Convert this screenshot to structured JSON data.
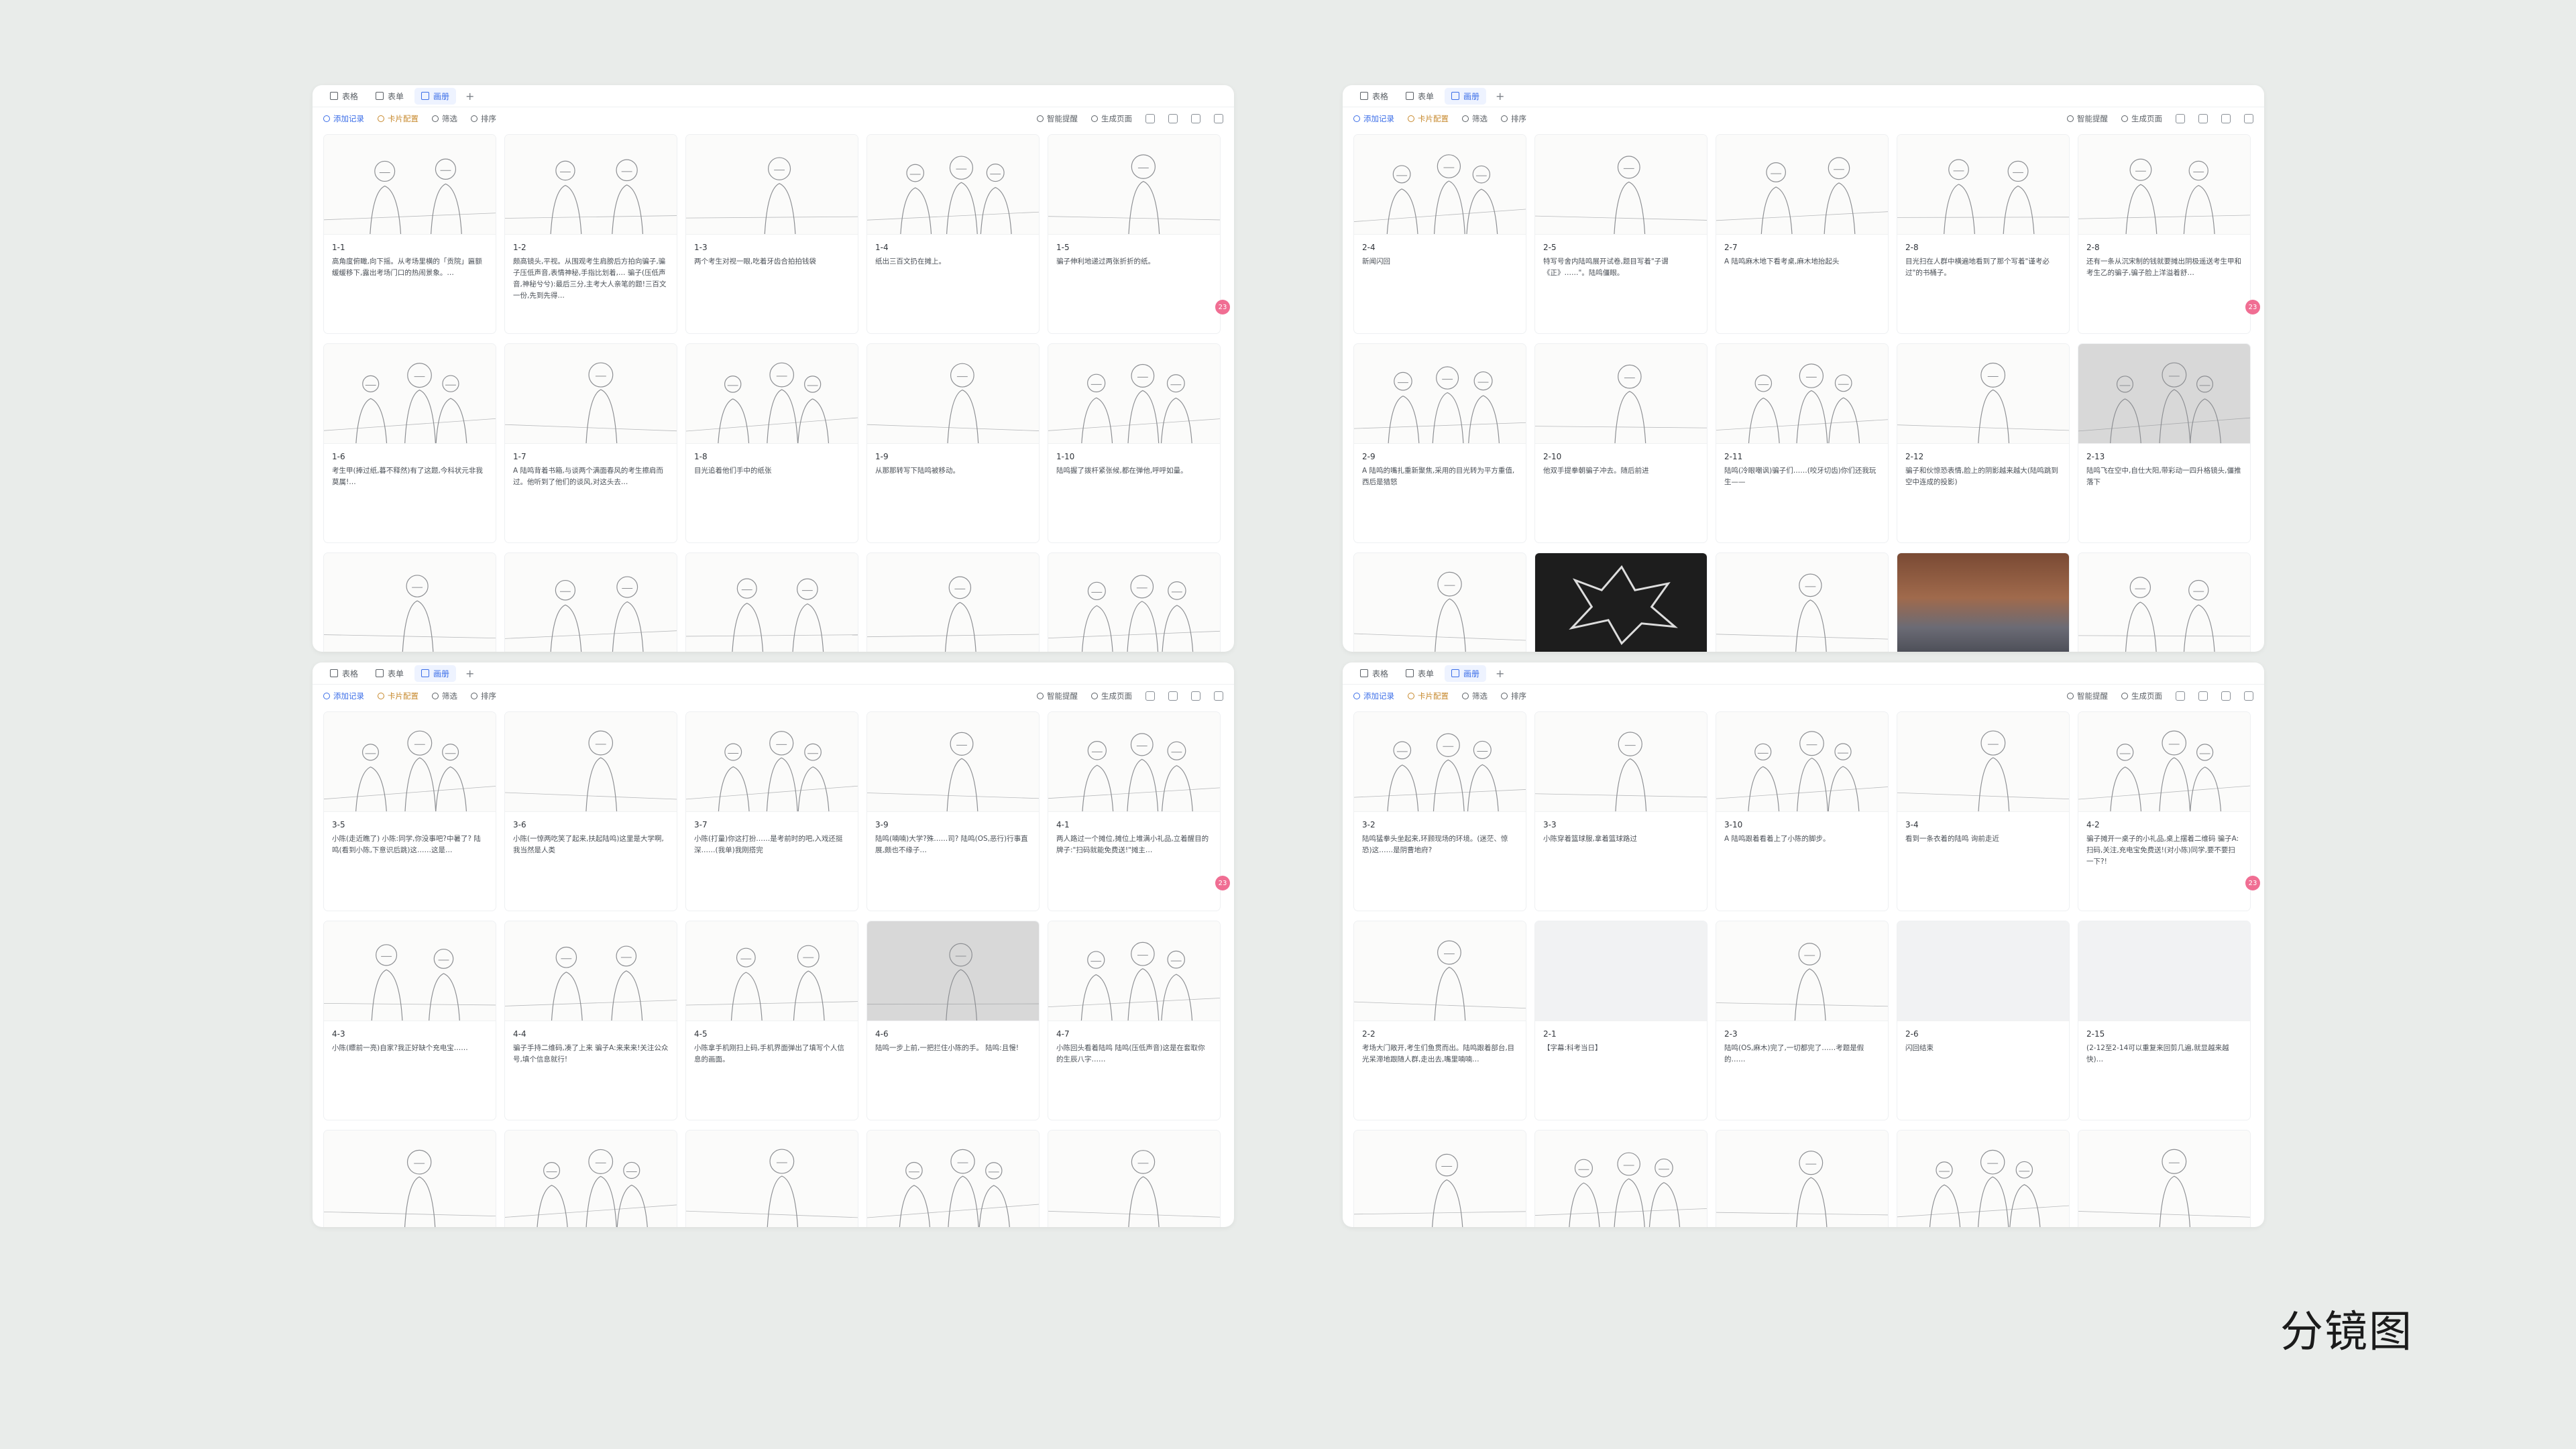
{
  "caption": "分镜图",
  "panels": [
    {
      "tabs": [
        "表格",
        "表单",
        "画册"
      ],
      "active_tab": 2,
      "toolbar": {
        "add": "添加记录",
        "card": "卡片配置",
        "filter": "筛选",
        "sort": "排序",
        "smart": "智能提醒",
        "gen": "生成页面"
      },
      "badge": "23",
      "cards": [
        {
          "id": "1-1",
          "desc": "高角度俯瞰,向下摇。从考场里横的「贡院」匾额缓缓移下,露出考场门口的热闹景象。…",
          "kind": "sketch"
        },
        {
          "id": "1-2",
          "desc": "颇高镜头,平视。从围观考生肩膀后方拍向骗子,骗子压低声音,表情神秘,手指比划着,…  骗子(压低声音,神秘兮兮):最后三分,主考大人亲笔的题!三百文一份,先到先得…",
          "kind": "sketch"
        },
        {
          "id": "1-3",
          "desc": "两个考生对视一眼,吃着牙齿合拍拍钱袋",
          "kind": "sketch"
        },
        {
          "id": "1-4",
          "desc": "纸出三百文扔在摊上。",
          "kind": "sketch"
        },
        {
          "id": "1-5",
          "desc": "骗子伸利地递过两张折折的纸。",
          "kind": "sketch"
        },
        {
          "id": "1-6",
          "desc": "考生甲(捧过纸,暮不释然)有了这题,今科状元非我莫属!…",
          "kind": "sketch"
        },
        {
          "id": "1-7",
          "desc": "A 陆鸣背着书箱,与谈两个满面春风的考生擦肩而过。他听到了他们的谈风,对这头去…",
          "kind": "sketch"
        },
        {
          "id": "1-8",
          "desc": "目光追着他们手中的纸张",
          "kind": "sketch"
        },
        {
          "id": "1-9",
          "desc": "从那那转写下陆鸣被移动。",
          "kind": "sketch"
        },
        {
          "id": "1-10",
          "desc": "陆鸣握了拨杆紧张候,都在弹他,呼呼如量。",
          "kind": "sketch"
        },
        {
          "id": "",
          "desc": "",
          "kind": "sketch"
        },
        {
          "id": "",
          "desc": "",
          "kind": "sketch"
        },
        {
          "id": "",
          "desc": "",
          "kind": "sketch"
        },
        {
          "id": "",
          "desc": "",
          "kind": "sketch"
        },
        {
          "id": "",
          "desc": "",
          "kind": "sketch"
        }
      ]
    },
    {
      "tabs": [
        "表格",
        "表单",
        "画册"
      ],
      "active_tab": 2,
      "toolbar": {
        "add": "添加记录",
        "card": "卡片配置",
        "filter": "筛选",
        "sort": "排序",
        "smart": "智能提醒",
        "gen": "生成页面"
      },
      "badge": "23",
      "cards": [
        {
          "id": "2-4",
          "desc": "新闻闪回",
          "kind": "sketch"
        },
        {
          "id": "2-5",
          "desc": "特写号舍内陆鸣展开试卷,题目写着\"子谓《正》……\"。陆鸣僵眼。",
          "kind": "sketch"
        },
        {
          "id": "2-7",
          "desc": "A 陆鸣麻木地下看考桌,麻木地抬起头",
          "kind": "sketch"
        },
        {
          "id": "2-8",
          "desc": "目光扫在人群中横遍地看到了那个写着\"谨考必过\"的书桶子。",
          "kind": "sketch"
        },
        {
          "id": "2-8",
          "desc": "还有一条从沉宋制的钱就要摊出阴极遥送考生甲和考生乙的骗子,骗子脸上洋溢着舒…",
          "kind": "sketch"
        },
        {
          "id": "2-9",
          "desc": "A 陆鸣的嘴扎重新聚焦,采用的目光转为平方重值,西后是猎怒",
          "kind": "sketch"
        },
        {
          "id": "2-10",
          "desc": "他双手提拳朝骗子冲去。随后前进",
          "kind": "sketch"
        },
        {
          "id": "2-11",
          "desc": "陆鸣(冷眼嘲讽)骗子们……(咬牙切齿)你们还我玩生——",
          "kind": "sketch"
        },
        {
          "id": "2-12",
          "desc": "骗子和伙惊恐表情,脸上的阴影越来越大(陆鸣跳到空中连成的投影)",
          "kind": "sketch"
        },
        {
          "id": "2-13",
          "desc": "陆鸣飞在空中,自仕大阳,带彩动一四升格镜头,僵推落下",
          "kind": "sketch-dark"
        },
        {
          "id": "",
          "desc": "",
          "kind": "sketch"
        },
        {
          "id": "",
          "desc": "",
          "kind": "dark"
        },
        {
          "id": "",
          "desc": "",
          "kind": "sketch"
        },
        {
          "id": "",
          "desc": "",
          "kind": "photo"
        },
        {
          "id": "",
          "desc": "",
          "kind": "sketch"
        }
      ]
    },
    {
      "tabs": [
        "表格",
        "表单",
        "画册"
      ],
      "active_tab": 2,
      "toolbar": {
        "add": "添加记录",
        "card": "卡片配置",
        "filter": "筛选",
        "sort": "排序",
        "smart": "智能提醒",
        "gen": "生成页面"
      },
      "badge": "23",
      "cards": [
        {
          "id": "3-5",
          "desc": "小陈(走近瞧了)  小陈:同学,你没事吧?中暑了?  陆鸣(看到小陈,下意识后跳)这……这是…",
          "kind": "sketch"
        },
        {
          "id": "3-6",
          "desc": "小陈(一惊两吃笑了起来,扶起陆鸣)这里是大学啊,我当然是人类",
          "kind": "sketch"
        },
        {
          "id": "3-7",
          "desc": "小陈(打量)你这打扮……是考前时的吧,入戏还挺深……(我单)我刚搭完",
          "kind": "sketch"
        },
        {
          "id": "3-9",
          "desc": "陆鸣(喃喃)大学?殊……司?  陆鸣(OS,恶行)行事直展,颇也不缘子…",
          "kind": "sketch"
        },
        {
          "id": "4-1",
          "desc": "两人路过一个摊位,摊位上堆满小礼品,立着醒目的牌子:\"扫码就能免费送!\"摊主…",
          "kind": "sketch"
        },
        {
          "id": "4-3",
          "desc": "小陈(瞟前一亮)自家?我正好缺个充电宝……",
          "kind": "sketch"
        },
        {
          "id": "4-4",
          "desc": "骗子手持二维码,凑了上来  骗子A:来来来!关注公众号,填个信息就行!",
          "kind": "sketch"
        },
        {
          "id": "4-5",
          "desc": "小陈拿手机刚扫上码,手机界面弹出了填写个人信息的画面。",
          "kind": "sketch"
        },
        {
          "id": "4-6",
          "desc": "陆鸣一步上前,一把拦住小陈的手。  陆鸣:且慢!",
          "kind": "sketch-dark"
        },
        {
          "id": "4-7",
          "desc": "小陈回头看着陆鸣  陆鸣(压低声音)这是在套取你的生辰八字……",
          "kind": "sketch"
        },
        {
          "id": "",
          "desc": "",
          "kind": "sketch"
        },
        {
          "id": "",
          "desc": "",
          "kind": "sketch"
        },
        {
          "id": "",
          "desc": "",
          "kind": "sketch"
        },
        {
          "id": "",
          "desc": "",
          "kind": "sketch"
        },
        {
          "id": "",
          "desc": "",
          "kind": "sketch"
        }
      ]
    },
    {
      "tabs": [
        "表格",
        "表单",
        "画册"
      ],
      "active_tab": 2,
      "toolbar": {
        "add": "添加记录",
        "card": "卡片配置",
        "filter": "筛选",
        "sort": "排序",
        "smart": "智能提醒",
        "gen": "生成页面"
      },
      "badge": "23",
      "cards": [
        {
          "id": "3-2",
          "desc": "陆鸣猛拳头坐起来,环顾现场的环境。(迷茫、惊恐)这……是阴曹地府?",
          "kind": "sketch"
        },
        {
          "id": "3-3",
          "desc": "小陈穿着篮球服,拿着篮球路过",
          "kind": "sketch"
        },
        {
          "id": "3-10",
          "desc": "A 陆鸣跟着看着上了小陈的脚步。",
          "kind": "sketch"
        },
        {
          "id": "3-4",
          "desc": "看到一条衣着的陆鸣  询前走近",
          "kind": "sketch"
        },
        {
          "id": "4-2",
          "desc": "骗子摊开一桌子的小礼品,桌上摆着二维码  骗子A:扫码,关注,充电宝免费送!(对小陈)同学,要不要扫一下?!",
          "kind": "sketch"
        },
        {
          "id": "2-2",
          "desc": "考场大门敞开,考生们鱼贯而出。陆鸣跟着部台,目光呆滞地跟随人群,走出去,嘴里喃喃…",
          "kind": "sketch"
        },
        {
          "id": "2-1",
          "desc": "【字幕:科考当日】",
          "kind": "blank"
        },
        {
          "id": "2-3",
          "desc": "陆鸣(OS,麻木)完了,一切都完了……考题是假的……",
          "kind": "sketch"
        },
        {
          "id": "2-6",
          "desc": "闪回结束",
          "kind": "blank"
        },
        {
          "id": "2-15",
          "desc": "(2-12至2-14可以重复来回剪几遍,就显越来越快)…",
          "kind": "blank"
        },
        {
          "id": "",
          "desc": "",
          "kind": "sketch"
        },
        {
          "id": "",
          "desc": "",
          "kind": "sketch"
        },
        {
          "id": "",
          "desc": "",
          "kind": "sketch"
        },
        {
          "id": "",
          "desc": "",
          "kind": "sketch"
        },
        {
          "id": "",
          "desc": "",
          "kind": "sketch"
        }
      ]
    }
  ]
}
